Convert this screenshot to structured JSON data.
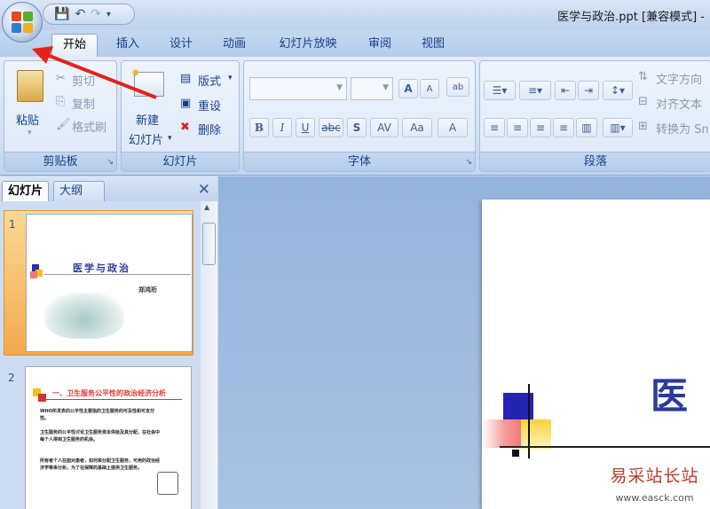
{
  "window": {
    "title": "医学与政治.ppt [兼容模式] -"
  },
  "tabs": [
    "开始",
    "插入",
    "设计",
    "动画",
    "幻灯片放映",
    "审阅",
    "视图"
  ],
  "ribbon": {
    "clipboard": {
      "paste": "粘贴",
      "cut": "剪切",
      "copy": "复制",
      "format_painter": "格式刷",
      "label": "剪贴板"
    },
    "slides": {
      "new_slide_1": "新建",
      "new_slide_2": "幻灯片",
      "layout": "版式",
      "reset": "重设",
      "delete": "删除",
      "label": "幻灯片"
    },
    "font": {
      "label": "字体",
      "bold": "B",
      "italic": "I",
      "underline": "U",
      "strike": "abc",
      "shadow": "S",
      "spacing": "AV",
      "case": "Aa",
      "color": "A",
      "grow": "A",
      "shrink": "A"
    },
    "paragraph": {
      "text_direction": "文字方向",
      "align_text": "对齐文本",
      "convert": "转换为 Sn",
      "label": "段落"
    }
  },
  "pane": {
    "tab_slides": "幻灯片",
    "tab_outline": "大纲",
    "close": "✕"
  },
  "slides": [
    {
      "num": "1",
      "title": "医学与政治",
      "author": "郑鸿珩"
    },
    {
      "num": "2",
      "title": "一、卫生服务公平性的政治经济分析",
      "bullets": [
        "WHO所发表的公平性主要指的卫生服务的可及性和可支付性。",
        "卫生服务的公平性讨论卫生服务资本供给及其分配，在社会中每个人得到卫生服务的机会。",
        "所有者个人在面对患者，如何来分配卫生服务，可用的政治经济学等来分析。为了在保障的基础上提供卫生服务。"
      ]
    }
  ],
  "main_slide": {
    "title_char": "医"
  },
  "watermark": {
    "line1": "易采站长站",
    "line2": "www.easck.com"
  },
  "colors": {
    "accent_red": "#e53935",
    "office_blue": "#15428b",
    "selection_orange": "#f3a94e"
  }
}
